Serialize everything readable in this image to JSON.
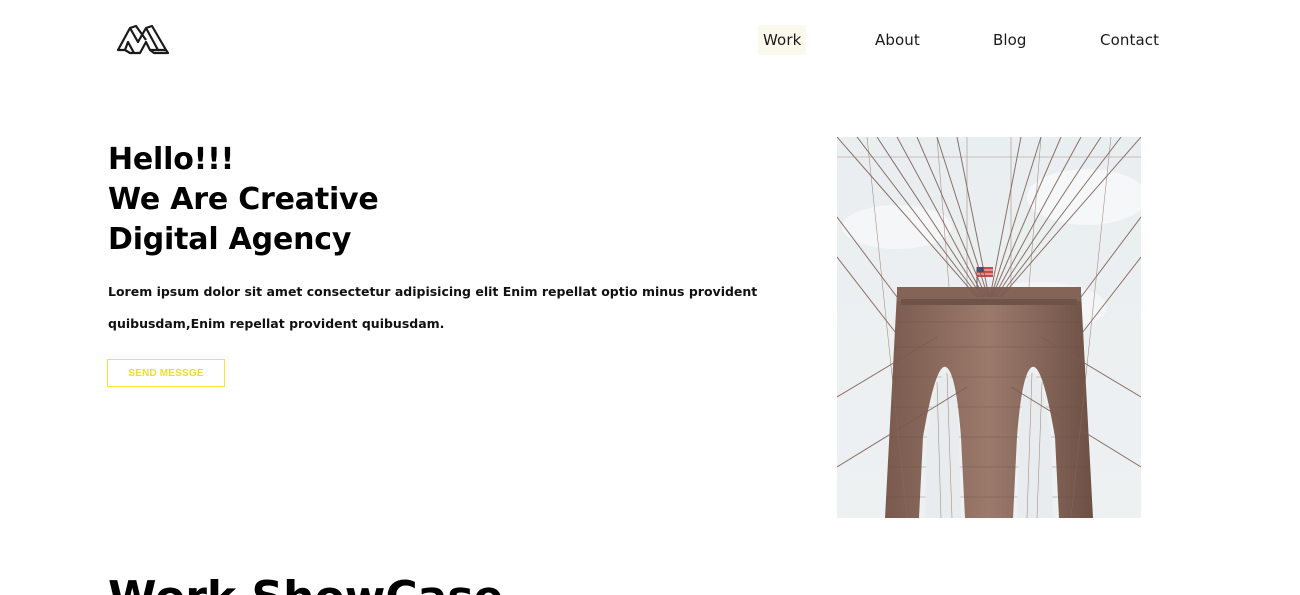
{
  "header": {
    "logo_name": "brand-logo",
    "nav": [
      {
        "label": "Work",
        "active": true
      },
      {
        "label": "About",
        "active": false
      },
      {
        "label": "Blog",
        "active": false
      },
      {
        "label": "Contact",
        "active": false
      }
    ]
  },
  "hero": {
    "title_lines": [
      "Hello!!!",
      "We Are Creative",
      "Digital Agency"
    ],
    "text_lines": [
      "Lorem ipsum dolor sit amet consectetur adipisicing elit Enim repellat optio minus provident",
      "quibusdam,Enim repellat provident quibusdam."
    ],
    "button_label": "SEND MESSGE",
    "image_subject": "bridge-photo"
  },
  "showcase": {
    "heading": "Work ShowCase"
  },
  "colors": {
    "accent_yellow": "#f5e33a",
    "nav_active_bg": "#fbf8ec",
    "text": "#000000",
    "background": "#ffffff"
  }
}
